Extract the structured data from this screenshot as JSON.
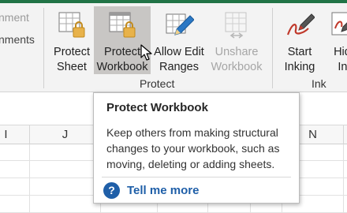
{
  "ribbon": {
    "left_partial": {
      "top_text": "nment",
      "mid_text": "nments"
    },
    "protect_group": {
      "label": "Protect",
      "buttons": [
        {
          "line1": "Protect",
          "line2": "Sheet",
          "icon": "protect-sheet-icon",
          "state": "normal"
        },
        {
          "line1": "Protect",
          "line2": "Workbook",
          "icon": "protect-workbook-icon",
          "state": "hover"
        },
        {
          "line1": "Allow Edit",
          "line2": "Ranges",
          "icon": "allow-edit-ranges-icon",
          "state": "normal"
        },
        {
          "line1": "Unshare",
          "line2": "Workbook",
          "icon": "unshare-workbook-icon",
          "state": "disabled"
        }
      ]
    },
    "ink_group": {
      "label": "Ink",
      "buttons": [
        {
          "line1": "Start",
          "line2": "Inking",
          "icon": "start-inking-icon"
        },
        {
          "line1": "Hide",
          "line2": "Ink",
          "icon": "hide-ink-icon"
        }
      ]
    }
  },
  "sheet": {
    "columns": [
      "I",
      "J",
      "",
      "",
      "",
      "",
      "N",
      ""
    ]
  },
  "tooltip": {
    "title": "Protect Workbook",
    "body_lines": [
      "Keep others from making structural",
      "changes to your workbook, such as",
      "moving, deleting or adding sheets."
    ],
    "help_icon_glyph": "?",
    "help_label": "Tell me more"
  },
  "colors": {
    "accent_green": "#217346",
    "lock_gold": "#e8b24a",
    "pencil_blue": "#2b78c5",
    "ink_red": "#c0392b",
    "help_blue": "#1f5fa8",
    "hover_gray": "#c8c6c4"
  }
}
